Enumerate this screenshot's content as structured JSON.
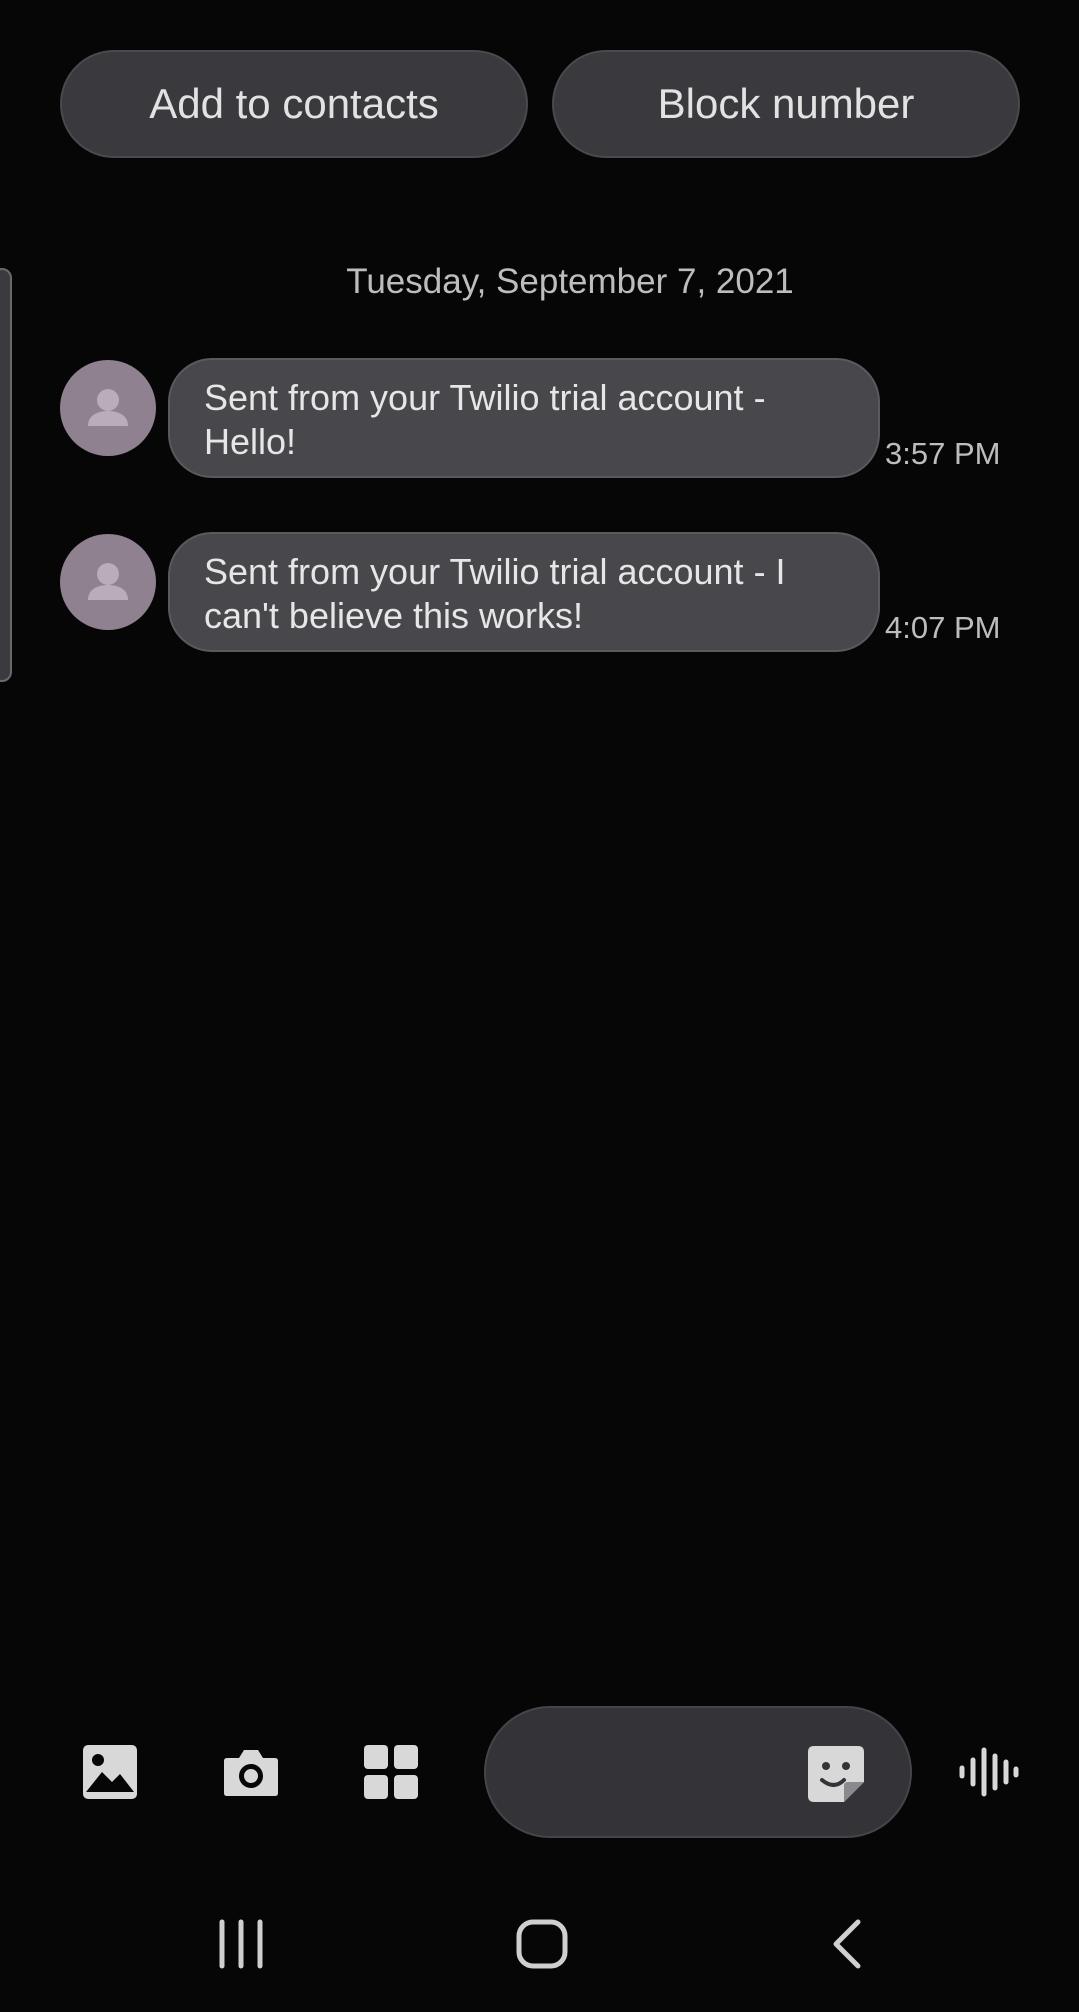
{
  "actions": {
    "add_to_contacts": "Add to contacts",
    "block_number": "Block number"
  },
  "conversation": {
    "date_header": "Tuesday, September 7, 2021",
    "messages": [
      {
        "line1": "Sent from your Twilio trial account -",
        "line2": "Hello!",
        "time": "3:57 PM"
      },
      {
        "line1": "Sent from your Twilio trial account - I",
        "line2": "can't believe this works!",
        "time": "4:07 PM"
      }
    ]
  },
  "composer": {
    "message_value": "",
    "tools": [
      "gallery-icon",
      "camera-icon",
      "apps-grid-icon"
    ],
    "sticker_icon": "sticker-icon",
    "voice_icon": "voice-recorder-icon"
  },
  "navigation": {
    "buttons": [
      "recent-apps-icon",
      "home-icon",
      "back-icon"
    ]
  },
  "colors": {
    "background": "#060606",
    "pill": "#3a393d",
    "bubble": "#48474b",
    "avatar": "#8f8190",
    "text": "#e6e6e6",
    "secondary_text": "#bdbdbd"
  }
}
